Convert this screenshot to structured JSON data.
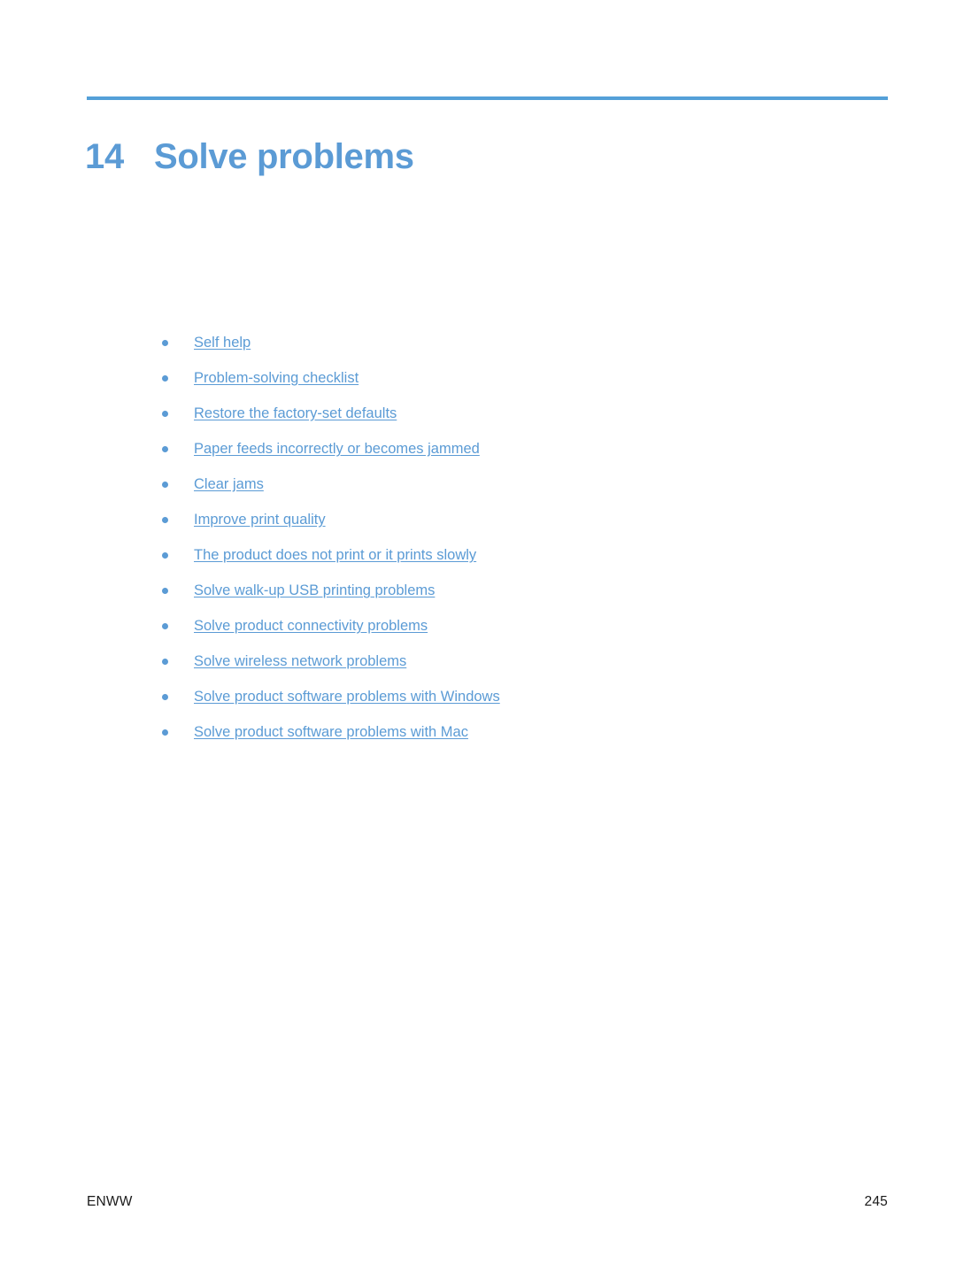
{
  "document": {
    "background_color": "#ffffff",
    "accent_color": "#5b9bd5",
    "rule_color": "#54a0d8"
  },
  "chapter": {
    "number": "14",
    "title": "Solve problems"
  },
  "toc": {
    "bullet_icon": "bullet-dot-icon",
    "items": [
      {
        "label": "Self help"
      },
      {
        "label": "Problem-solving checklist"
      },
      {
        "label": "Restore the factory-set defaults"
      },
      {
        "label": "Paper feeds incorrectly or becomes jammed"
      },
      {
        "label": "Clear jams"
      },
      {
        "label": "Improve print quality"
      },
      {
        "label": "The product does not print or it prints slowly"
      },
      {
        "label": "Solve walk-up USB printing problems"
      },
      {
        "label": "Solve product connectivity problems"
      },
      {
        "label": "Solve wireless network problems"
      },
      {
        "label": "Solve product software problems with Windows"
      },
      {
        "label": "Solve product software problems with Mac"
      }
    ]
  },
  "footer": {
    "left": "ENWW",
    "page_number": "245"
  }
}
